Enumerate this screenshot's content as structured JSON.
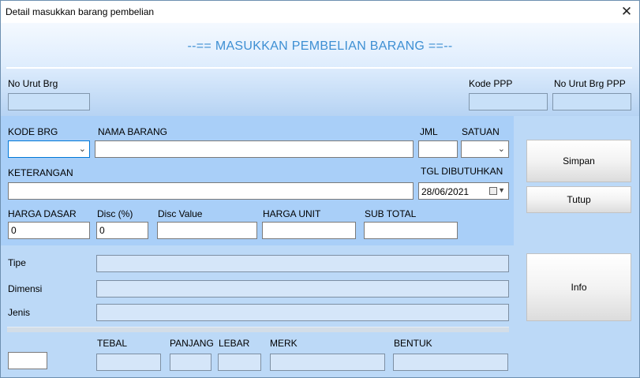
{
  "window": {
    "title": "Detail masukkan barang pembelian",
    "close_glyph": "✕"
  },
  "header": {
    "title": "--== MASUKKAN PEMBELIAN BARANG ==--"
  },
  "top": {
    "no_urut_label": "No Urut Brg",
    "kode_ppp_label": "Kode PPP",
    "no_urut_ppp_label": "No Urut Brg PPP"
  },
  "form": {
    "kode_brg_label": "KODE BRG",
    "nama_barang_label": "NAMA BARANG",
    "jml_label": "JML",
    "satuan_label": "SATUAN",
    "keterangan_label": "KETERANGAN",
    "tgl_label": "TGL DIBUTUHKAN",
    "tgl_value": "28/06/2021",
    "harga_dasar_label": "HARGA DASAR",
    "harga_dasar_value": "0",
    "disc_pct_label": "Disc (%)",
    "disc_pct_value": "0",
    "disc_value_label": "Disc Value",
    "harga_unit_label": "HARGA UNIT",
    "sub_total_label": "SUB TOTAL"
  },
  "info": {
    "tipe_label": "Tipe",
    "dimensi_label": "Dimensi",
    "jenis_label": "Jenis",
    "tebal_label": "TEBAL",
    "panjang_label": "PANJANG",
    "lebar_label": "LEBAR",
    "merk_label": "MERK",
    "bentuk_label": "BENTUK"
  },
  "buttons": {
    "simpan": "Simpan",
    "tutup": "Tutup",
    "info": "Info"
  },
  "icons": {
    "dropdown": "chevron-down-icon",
    "calendar": "calendar-icon",
    "close": "close-icon"
  },
  "colors": {
    "accent": "#3d8fd3",
    "form_panel": "#a9cff8",
    "body": "#bcd9f7",
    "focus": "#0078d7"
  }
}
